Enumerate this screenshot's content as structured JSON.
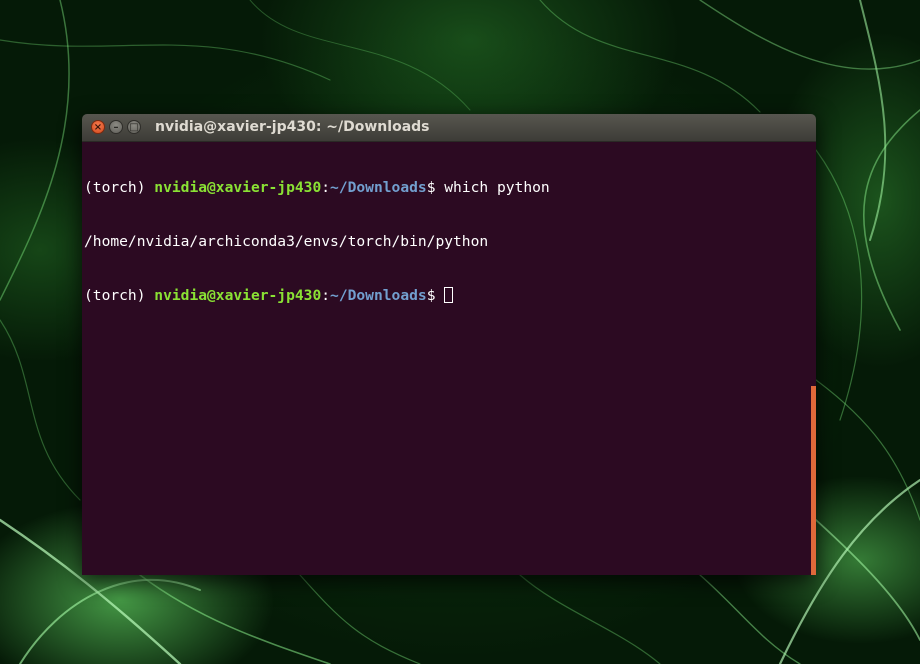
{
  "window": {
    "title": "nvidia@xavier-jp430: ~/Downloads",
    "buttons": {
      "close": "×",
      "minimize": "–",
      "maximize": "□"
    }
  },
  "terminal": {
    "lines": [
      {
        "env": "(torch) ",
        "user_host": "nvidia@xavier-jp430",
        "colon": ":",
        "path": "~/Downloads",
        "dollar": "$ ",
        "command": "which python"
      },
      {
        "output": "/home/nvidia/archiconda3/envs/torch/bin/python"
      },
      {
        "env": "(torch) ",
        "user_host": "nvidia@xavier-jp430",
        "colon": ":",
        "path": "~/Downloads",
        "dollar": "$ ",
        "command": ""
      }
    ]
  },
  "colors": {
    "terminal_background": "#2c0a22",
    "user_host": "#8ae234",
    "path": "#729fcf",
    "scrollbar": "#e0693a",
    "close_button": "#e3592b"
  },
  "icons": {
    "close": "close-icon",
    "minimize": "minimize-icon",
    "maximize": "maximize-icon"
  }
}
